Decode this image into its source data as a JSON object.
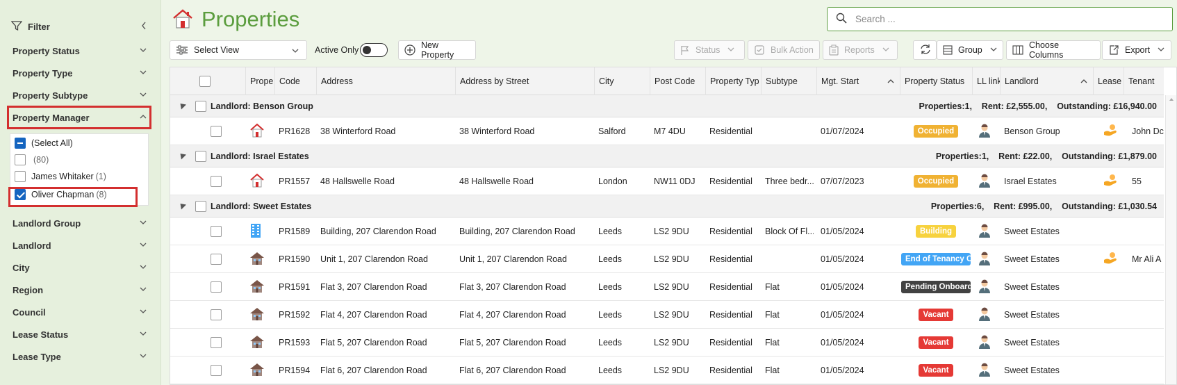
{
  "sidebar": {
    "filter_label": "Filter",
    "sections": {
      "property_status": "Property Status",
      "property_type": "Property Type",
      "property_subtype": "Property Subtype",
      "property_manager": "Property Manager",
      "landlord_group": "Landlord Group",
      "landlord": "Landlord",
      "city": "City",
      "region": "Region",
      "council": "Council",
      "lease_status": "Lease Status",
      "lease_type": "Lease Type"
    },
    "pm_options": {
      "select_all": "(Select All)",
      "blank_count": "(80)",
      "james": "James Whitaker",
      "james_count": "(1)",
      "oliver": "Oliver Chapman",
      "oliver_count": "(8)"
    }
  },
  "header": {
    "title": "Properties",
    "search_placeholder": "Search ..."
  },
  "toolbar": {
    "select_view": "Select View",
    "active_only": "Active Only",
    "new_property": "New Property",
    "status": "Status",
    "bulk_action": "Bulk Action",
    "reports": "Reports",
    "group": "Group",
    "choose_columns": "Choose Columns",
    "export": "Export"
  },
  "columns": {
    "prope": "Prope",
    "code": "Code",
    "address": "Address",
    "address_by_street": "Address by Street",
    "city": "City",
    "post_code": "Post Code",
    "property_type": "Property Typ",
    "subtype": "Subtype",
    "mgt_start": "Mgt. Start",
    "property_status": "Property Status",
    "ll_link": "LL link",
    "landlord": "Landlord",
    "lease": "Lease",
    "tenant": "Tenant"
  },
  "groups": [
    {
      "title": "Landlord: Benson Group",
      "summary": "Properties:1,    Rent: £2,555.00,    Outstanding: £16,940.00",
      "rows": [
        {
          "icon": "house-red-icon",
          "code": "PR1628",
          "address": "38 Winterford Road",
          "street": "38 Winterford Road",
          "city": "Salford",
          "post": "M7 4DU",
          "type": "Residential",
          "subtype": "",
          "mgt": "01/07/2024",
          "status": "Occupied",
          "status_color": "#f0b233",
          "landlord": "Benson Group",
          "lease": true,
          "tenant": "John Dc"
        }
      ]
    },
    {
      "title": "Landlord: Israel Estates",
      "summary": "Properties:1,    Rent: £22.00,    Outstanding: £1,879.00",
      "rows": [
        {
          "icon": "house-red-icon",
          "code": "PR1557",
          "address": "48 Hallswelle Road",
          "street": "48 Hallswelle Road",
          "city": "London",
          "post": "NW11 0DJ",
          "type": "Residential",
          "subtype": "Three bedr...",
          "mgt": "07/07/2023",
          "status": "Occupied",
          "status_color": "#f0b233",
          "landlord": "Israel Estates",
          "lease": true,
          "tenant": "55"
        }
      ]
    },
    {
      "title": "Landlord: Sweet Estates",
      "summary": "Properties:6,    Rent: £995.00,    Outstanding: £1,030.54",
      "rows": [
        {
          "icon": "building-icon",
          "code": "PR1589",
          "address": "Building, 207 Clarendon Road",
          "street": "Building, 207 Clarendon Road",
          "city": "Leeds",
          "post": "LS2 9DU",
          "type": "Residential",
          "subtype": "Block Of Fl...",
          "mgt": "01/05/2024",
          "status": "Building",
          "status_color": "#f7d23e",
          "landlord": "Sweet Estates",
          "lease": false,
          "tenant": ""
        },
        {
          "icon": "house-brown-icon",
          "code": "PR1590",
          "address": "Unit 1, 207 Clarendon Road",
          "street": "Unit 1, 207 Clarendon Road",
          "city": "Leeds",
          "post": "LS2 9DU",
          "type": "Residential",
          "subtype": "",
          "mgt": "01/05/2024",
          "status": "End of Tenancy Cle",
          "status_color": "#42a5f5",
          "landlord": "Sweet Estates",
          "lease": true,
          "tenant": "Mr Ali A"
        },
        {
          "icon": "house-brown-icon",
          "code": "PR1591",
          "address": "Flat 3, 207 Clarendon Road",
          "street": "Flat 3, 207 Clarendon Road",
          "city": "Leeds",
          "post": "LS2 9DU",
          "type": "Residential",
          "subtype": "Flat",
          "mgt": "01/05/2024",
          "status": "Pending Onboardi",
          "status_color": "#424242",
          "landlord": "Sweet Estates",
          "lease": false,
          "tenant": ""
        },
        {
          "icon": "house-brown-icon",
          "code": "PR1592",
          "address": "Flat 4, 207 Clarendon Road",
          "street": "Flat 4, 207 Clarendon Road",
          "city": "Leeds",
          "post": "LS2 9DU",
          "type": "Residential",
          "subtype": "Flat",
          "mgt": "01/05/2024",
          "status": "Vacant",
          "status_color": "#e53935",
          "landlord": "Sweet Estates",
          "lease": false,
          "tenant": ""
        },
        {
          "icon": "house-brown-icon",
          "code": "PR1593",
          "address": "Flat 5, 207 Clarendon Road",
          "street": "Flat 5, 207 Clarendon Road",
          "city": "Leeds",
          "post": "LS2 9DU",
          "type": "Residential",
          "subtype": "Flat",
          "mgt": "01/05/2024",
          "status": "Vacant",
          "status_color": "#e53935",
          "landlord": "Sweet Estates",
          "lease": false,
          "tenant": ""
        },
        {
          "icon": "house-brown-icon",
          "code": "PR1594",
          "address": "Flat 6, 207 Clarendon Road",
          "street": "Flat 6, 207 Clarendon Road",
          "city": "Leeds",
          "post": "LS2 9DU",
          "type": "Residential",
          "subtype": "Flat",
          "mgt": "01/05/2024",
          "status": "Vacant",
          "status_color": "#e53935",
          "landlord": "Sweet Estates",
          "lease": false,
          "tenant": ""
        }
      ]
    }
  ]
}
